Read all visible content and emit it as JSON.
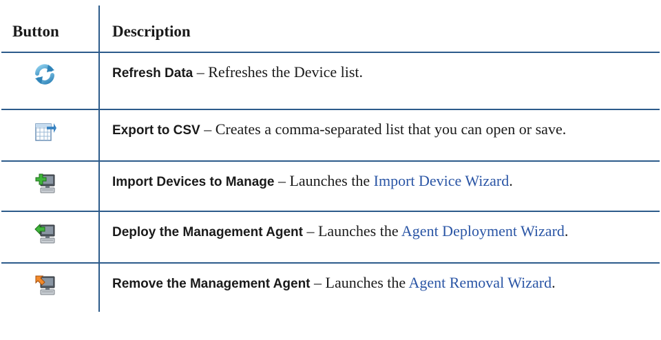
{
  "header": {
    "button_col": "Button",
    "description_col": "Description"
  },
  "rows": [
    {
      "icon": "refresh-icon",
      "name": "Refresh Data",
      "separator": " – ",
      "text": "Refreshes the Device list.",
      "link": "",
      "end": ""
    },
    {
      "icon": "export-csv-icon",
      "name": "Export to CSV",
      "separator": " – ",
      "text": "Creates a comma-separated list that you can open or save.",
      "link": "",
      "end": ""
    },
    {
      "icon": "import-devices-icon",
      "name": "Import Devices to Manage",
      "separator": " – ",
      "text": "Launches the ",
      "link": "Import Device Wizard",
      "end": "."
    },
    {
      "icon": "deploy-agent-icon",
      "name": "Deploy the Management Agent",
      "separator": " – ",
      "text": "Launches the ",
      "link": "Agent Deployment Wizard",
      "end": "."
    },
    {
      "icon": "remove-agent-icon",
      "name": "Remove the Management Agent",
      "separator": " – ",
      "text": "Launches the ",
      "link": "Agent Removal Wizard",
      "end": "."
    }
  ],
  "colors": {
    "rule": "#2b5a8a",
    "link": "#2a55a5"
  }
}
